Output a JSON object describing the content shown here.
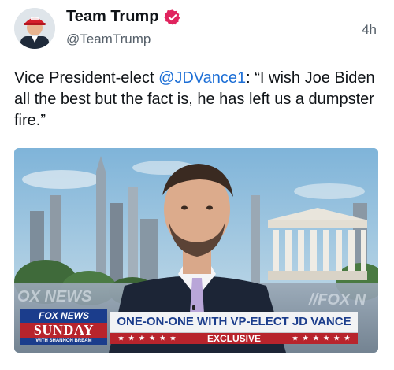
{
  "author": {
    "name": "Team Trump",
    "handle": "@TeamTrump",
    "time": "4h",
    "verified": true
  },
  "tweet": {
    "text_before": "Vice President-elect ",
    "mention": "@JDVance1",
    "text_after": ": “I wish Joe Biden all the best but the fact is, he has left us a dumpster fire.”"
  },
  "media": {
    "network_bug": {
      "top": "FOX NEWS",
      "middle": "SUNDAY",
      "bottom": "WITH SHANNON BREAM"
    },
    "headline": "ONE-ON-ONE WITH VP-ELECT JD VANCE",
    "tag": "EXCLUSIVE",
    "background_wall_text_left": "OX NEWS",
    "background_wall_text_right": "//FOX N"
  },
  "colors": {
    "mention_blue": "#1d6fd6",
    "verified_red": "#e0245e",
    "fox_blue": "#1b3d8c",
    "fox_red": "#b8242c"
  }
}
